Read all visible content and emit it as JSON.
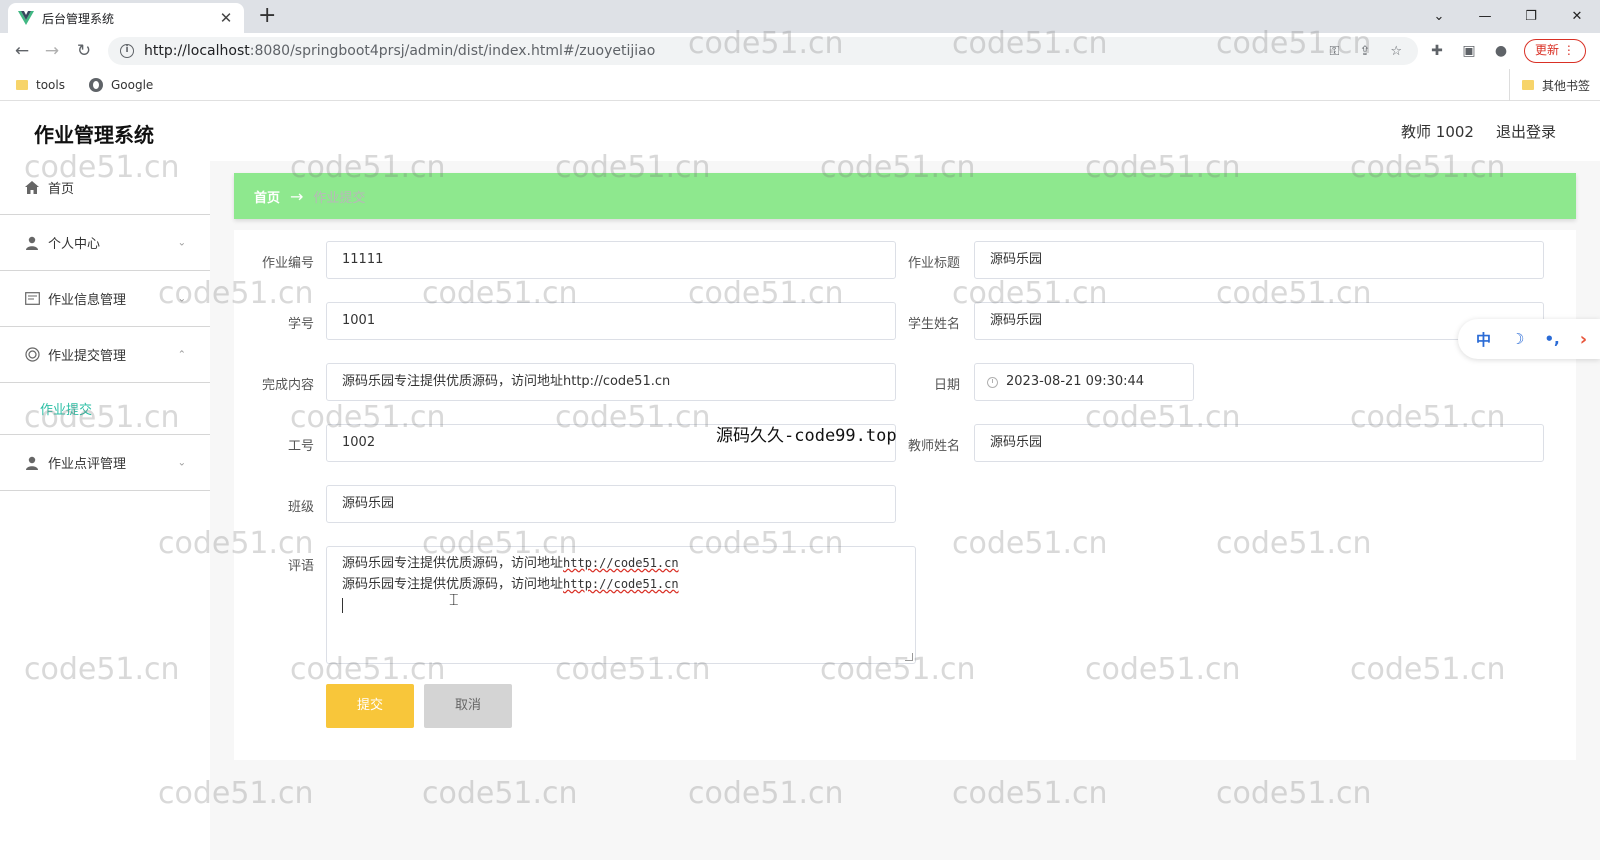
{
  "browser": {
    "tab_title": "后台管理系统",
    "tab_close": "✕",
    "new_tab": "+",
    "window_controls": [
      "⌄",
      "—",
      "❐",
      "✕"
    ],
    "url_host": "http://localhost",
    "url_path": ":8080/springboot4prsj/admin/dist/index.html#/zuoyetijiao",
    "update_label": "更新",
    "bookmarks": [
      "tools",
      "Google"
    ],
    "other_bookmarks": "其他书签"
  },
  "app": {
    "title": "作业管理系统",
    "user": "教师 1002",
    "logout": "退出登录"
  },
  "sidebar": {
    "items": [
      {
        "label": "首页",
        "icon": "home-icon"
      },
      {
        "label": "个人中心",
        "icon": "user-icon"
      },
      {
        "label": "作业信息管理",
        "icon": "document-icon"
      },
      {
        "label": "作业提交管理",
        "icon": "circle-icon"
      },
      {
        "label": "作业点评管理",
        "icon": "user-icon"
      }
    ],
    "active_sub": "作业提交"
  },
  "breadcrumb": {
    "home": "首页",
    "arrow": "→",
    "current": "作业提交"
  },
  "form": {
    "homework_no": {
      "label": "作业编号",
      "value": "11111"
    },
    "homework_title": {
      "label": "作业标题",
      "value": "源码乐园"
    },
    "student_no": {
      "label": "学号",
      "value": "1001"
    },
    "student_name": {
      "label": "学生姓名",
      "value": "源码乐园"
    },
    "content": {
      "label": "完成内容",
      "value": "源码乐园专注提供优质源码，访问地址http://code51.cn"
    },
    "date": {
      "label": "日期",
      "value": "2023-08-21 09:30:44"
    },
    "staff_no": {
      "label": "工号",
      "value": "1002"
    },
    "teacher_name": {
      "label": "教师姓名",
      "value": "源码乐园"
    },
    "class": {
      "label": "班级",
      "value": "源码乐园"
    },
    "comment": {
      "label": "评语",
      "lines": [
        {
          "text": "源码乐园专注提供优质源码，访问地址",
          "link": "http://code51.cn"
        },
        {
          "text": "源码乐园专注提供优质源码，访问地址",
          "link": "http://code51.cn"
        }
      ]
    },
    "submit": "提交",
    "cancel": "取消"
  },
  "overlay_text": "源码久久-code99.top",
  "float_toolbar": [
    "中",
    "☽",
    "•,",
    "›"
  ],
  "watermark": "code51.cn"
}
